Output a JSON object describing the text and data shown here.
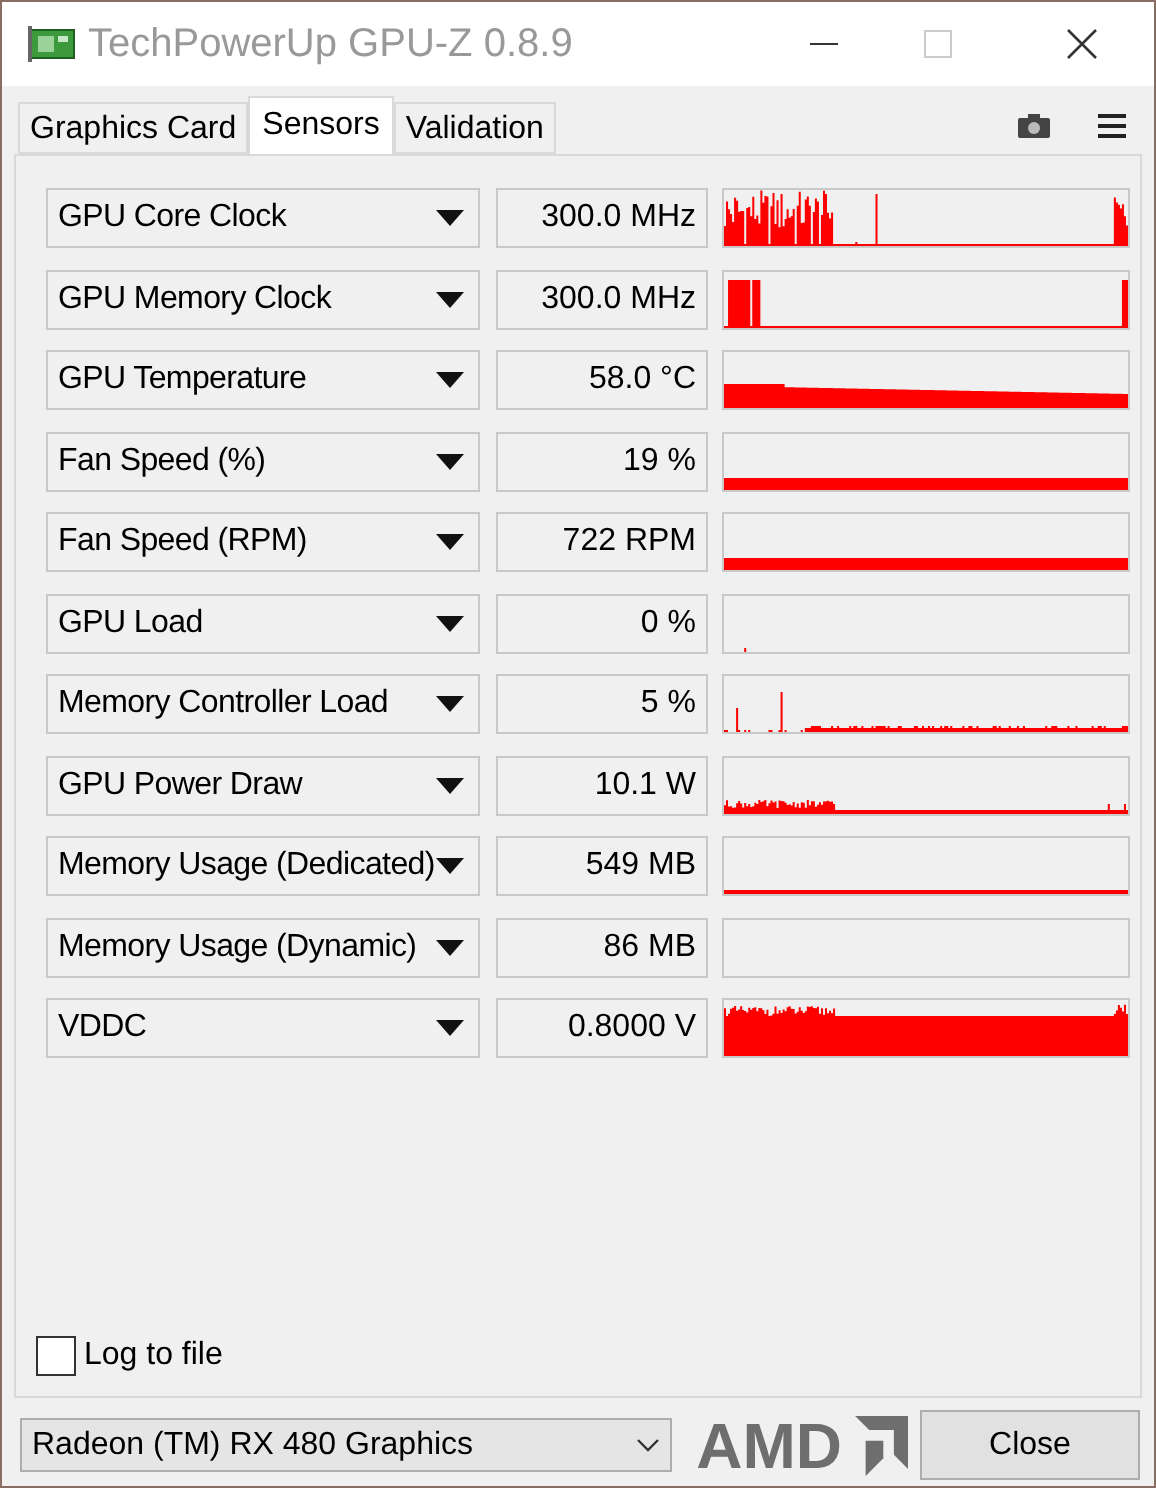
{
  "window": {
    "title": "TechPowerUp GPU-Z 0.8.9"
  },
  "tabs": [
    {
      "label": "Graphics Card",
      "selected": false
    },
    {
      "label": "Sensors",
      "selected": true
    },
    {
      "label": "Validation",
      "selected": false
    }
  ],
  "sensors": [
    {
      "name": "GPU Core Clock",
      "value": "300.0 MHz",
      "kind": "burst"
    },
    {
      "name": "GPU Memory Clock",
      "value": "300.0 MHz",
      "kind": "block"
    },
    {
      "name": "GPU Temperature",
      "value": "58.0 °C",
      "kind": "fill_mid"
    },
    {
      "name": "Fan Speed (%)",
      "value": "19 %",
      "kind": "fill_low"
    },
    {
      "name": "Fan Speed (RPM)",
      "value": "722 RPM",
      "kind": "fill_low"
    },
    {
      "name": "GPU Load",
      "value": "0 %",
      "kind": "dot"
    },
    {
      "name": "Memory Controller Load",
      "value": "5 %",
      "kind": "sparse"
    },
    {
      "name": "GPU Power Draw",
      "value": "10.1 W",
      "kind": "low_burst"
    },
    {
      "name": "Memory Usage (Dedicated)",
      "value": "549 MB",
      "kind": "line"
    },
    {
      "name": "Memory Usage (Dynamic)",
      "value": "86 MB",
      "kind": "empty"
    },
    {
      "name": "VDDC",
      "value": "0.8000 V",
      "kind": "fill_high"
    }
  ],
  "log_to_file": {
    "label": "Log to file",
    "checked": false
  },
  "gpu_select": {
    "value": "Radeon (TM) RX 480 Graphics"
  },
  "logo": "AMD",
  "close_button": "Close"
}
